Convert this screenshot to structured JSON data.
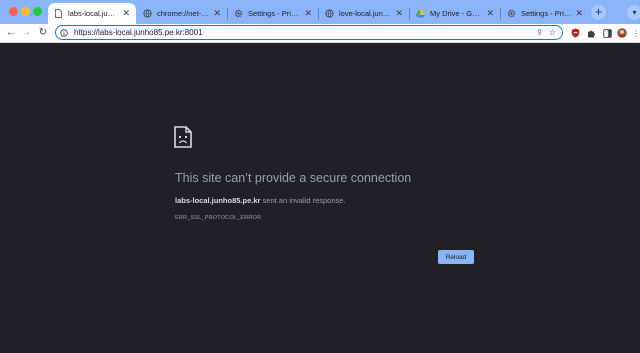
{
  "window": {
    "controls": [
      "close",
      "minimize",
      "maximize"
    ]
  },
  "tabs": [
    {
      "title": "labs-local.junho85.p",
      "icon": "sad-document-icon",
      "active": true
    },
    {
      "title": "chrome://net-interna",
      "icon": "globe-icon",
      "active": false
    },
    {
      "title": "Settings - Privacy a",
      "icon": "gear-icon",
      "active": false
    },
    {
      "title": "love-local.junho85.p",
      "icon": "globe-icon",
      "active": false
    },
    {
      "title": "My Drive - Google D",
      "icon": "google-drive-icon",
      "active": false
    },
    {
      "title": "Settings - Privacy a",
      "icon": "gear-icon",
      "active": false
    }
  ],
  "toolbar": {
    "url": "https://labs-local.junho85.pe.kr:8001"
  },
  "error": {
    "title": "This site can’t provide a secure connection",
    "host": "labs-local.junho85.pe.kr",
    "message": " sent an invalid response.",
    "code": "ERR_SSL_PROTOCOL_ERROR",
    "reload_label": "Reload"
  },
  "colors": {
    "tabstrip": "#8ab4f8",
    "page_background": "#202124",
    "reload_button": "#8ab4f8"
  }
}
